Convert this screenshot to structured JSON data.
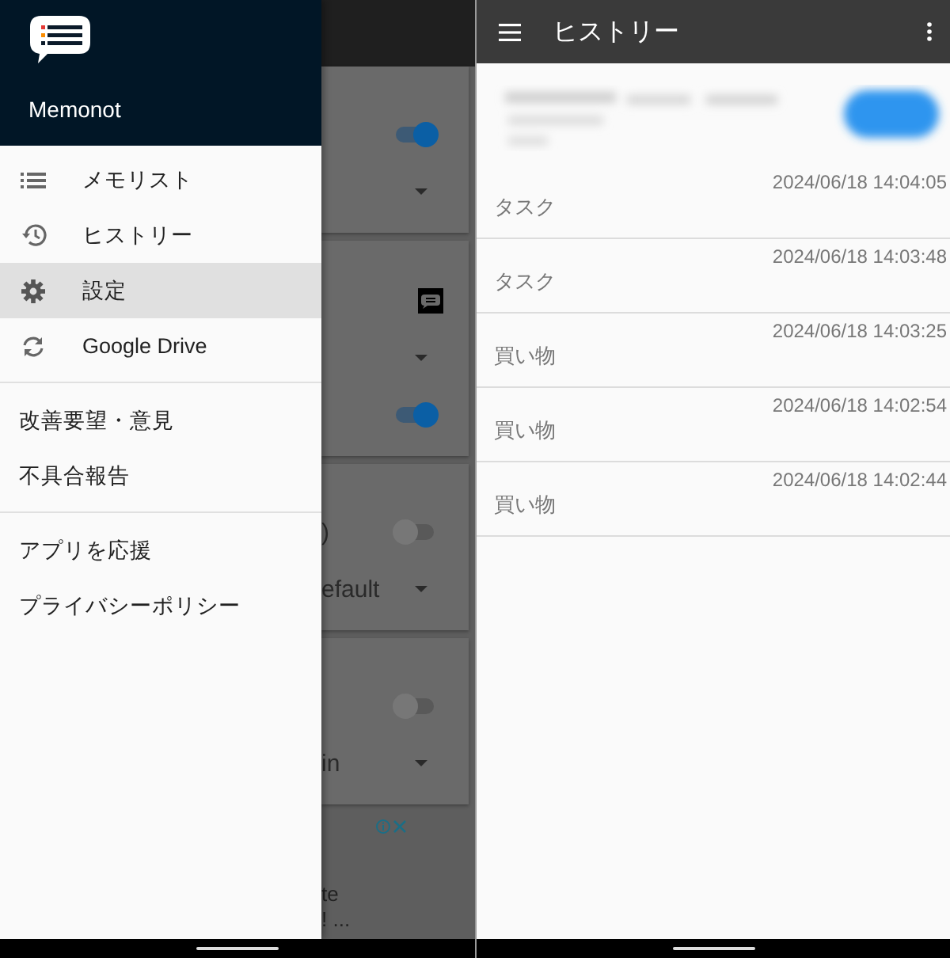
{
  "drawer": {
    "app_name": "Memonot",
    "items": [
      {
        "label": "メモリスト",
        "selected": false
      },
      {
        "label": "ヒストリー",
        "selected": false
      },
      {
        "label": "設定",
        "selected": true
      },
      {
        "label": "Google Drive",
        "selected": false
      }
    ],
    "link_groups": [
      [
        "改善要望・意見",
        "不具合報告"
      ],
      [
        "アプリを応援",
        "プライバシーポリシー"
      ]
    ]
  },
  "settings_behind": {
    "cards": [
      {
        "rows": [
          {
            "kind": "toggle",
            "on": true
          },
          {
            "kind": "dropdown"
          }
        ]
      },
      {
        "rows": [
          {
            "kind": "chat-icon"
          },
          {
            "kind": "dropdown"
          },
          {
            "kind": "toggle",
            "on": true
          }
        ]
      },
      {
        "rows": [
          {
            "kind": "toggle",
            "on": false,
            "text": ")"
          },
          {
            "kind": "dropdown",
            "text": "efault"
          }
        ]
      },
      {
        "rows": [
          {
            "kind": "toggle",
            "on": false
          },
          {
            "kind": "dropdown",
            "text": "in"
          }
        ]
      }
    ],
    "ad_lines": [
      "te",
      "! ..."
    ]
  },
  "history": {
    "title": "ヒストリー",
    "entries": [
      {
        "name": "タスク",
        "time": "2024/06/18 14:04:05"
      },
      {
        "name": "タスク",
        "time": "2024/06/18 14:03:48"
      },
      {
        "name": "買い物",
        "time": "2024/06/18 14:03:25"
      },
      {
        "name": "買い物",
        "time": "2024/06/18 14:02:54"
      },
      {
        "name": "買い物",
        "time": "2024/06/18 14:02:44"
      }
    ]
  }
}
